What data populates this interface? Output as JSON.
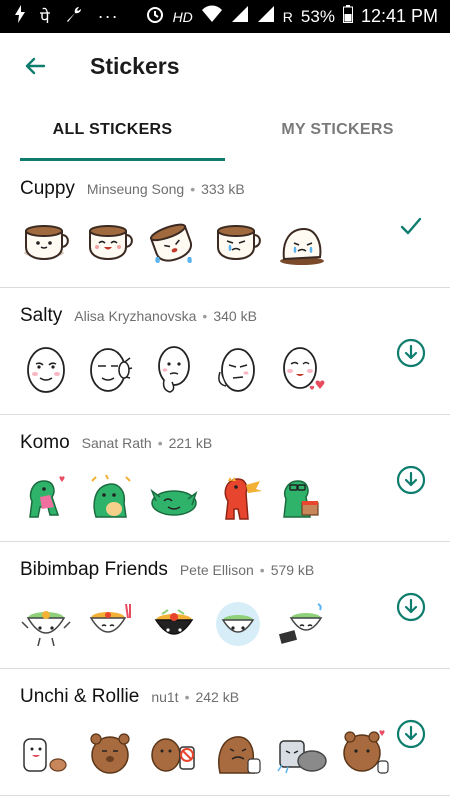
{
  "status_bar": {
    "time": "12:41 PM",
    "battery": "53%",
    "network": "HD",
    "roaming": "R",
    "more": "···",
    "notif_text": "पे"
  },
  "app_bar": {
    "title": "Stickers"
  },
  "tabs": [
    {
      "label": "ALL STICKERS",
      "active": true
    },
    {
      "label": "MY STICKERS",
      "active": false
    }
  ],
  "packs": [
    {
      "name": "Cuppy",
      "author": "Minseung Song",
      "size": "333 kB",
      "state": "installed",
      "theme": "cup"
    },
    {
      "name": "Salty",
      "author": "Alisa Kryzhanovska",
      "size": "340 kB",
      "state": "download",
      "theme": "face"
    },
    {
      "name": "Komo",
      "author": "Sanat Rath",
      "size": "221 kB",
      "state": "download",
      "theme": "dino"
    },
    {
      "name": "Bibimbap Friends",
      "author": "Pete Ellison",
      "size": "579 kB",
      "state": "download",
      "theme": "bowl"
    },
    {
      "name": "Unchi & Rollie",
      "author": "nu1t",
      "size": "242 kB",
      "state": "download",
      "theme": "bear"
    }
  ],
  "colors": {
    "accent": "#0e7d6e",
    "divider": "#dcdcdc"
  }
}
